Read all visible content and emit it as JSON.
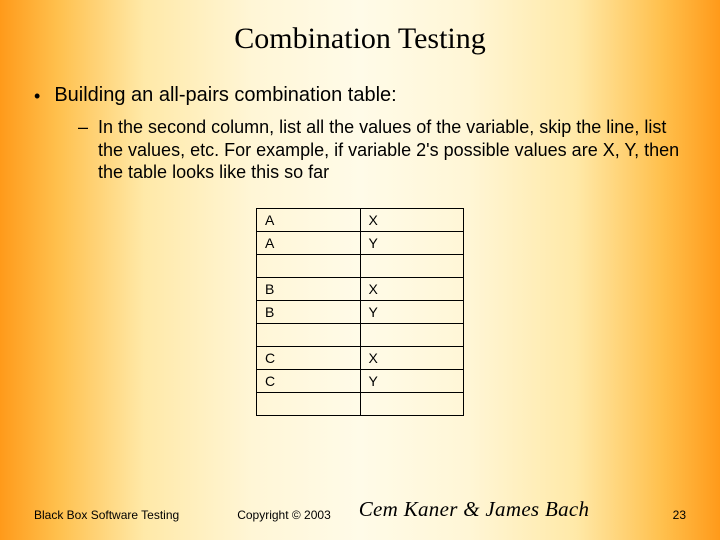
{
  "title": "Combination Testing",
  "bullets": {
    "level1": "Building an all-pairs combination table:",
    "level2": "In the second column, list all the values of the variable, skip the line, list the values, etc. For example, if variable 2's possible values are X, Y, then the table looks like this so far"
  },
  "table": {
    "rows": [
      {
        "c1": "A",
        "c2": "X"
      },
      {
        "c1": "A",
        "c2": "Y"
      },
      {
        "c1": "",
        "c2": ""
      },
      {
        "c1": "B",
        "c2": "X"
      },
      {
        "c1": "B",
        "c2": "Y"
      },
      {
        "c1": "",
        "c2": ""
      },
      {
        "c1": "C",
        "c2": "X"
      },
      {
        "c1": "C",
        "c2": "Y"
      },
      {
        "c1": "",
        "c2": ""
      }
    ]
  },
  "footer": {
    "left": "Black Box Software Testing",
    "copyright": "Copyright © 2003",
    "authors": "Cem Kaner & James Bach",
    "page": "23"
  }
}
